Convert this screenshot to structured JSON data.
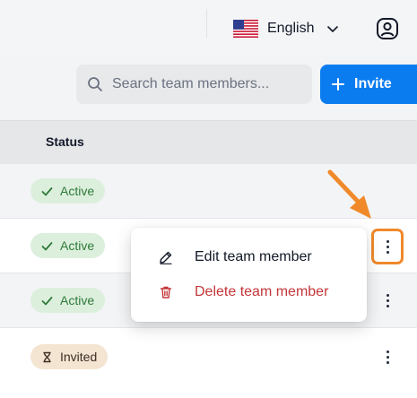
{
  "header": {
    "language": "English",
    "language_flag_icon": "us-flag-icon",
    "profile_icon": "user-circle-icon"
  },
  "toolbar": {
    "search_placeholder": "Search team members...",
    "invite_label": "Invite"
  },
  "table": {
    "columns": [
      "Status"
    ],
    "rows": [
      {
        "status": "Active",
        "type": "active"
      },
      {
        "status": "Active",
        "type": "active"
      },
      {
        "status": "Active",
        "type": "active"
      },
      {
        "status": "Invited",
        "type": "invited"
      }
    ]
  },
  "context_menu": {
    "edit_label": "Edit team member",
    "delete_label": "Delete team member"
  },
  "colors": {
    "accent": "#0a7cf0",
    "highlight": "#f0892a",
    "danger": "#c3363a",
    "active_bg": "#dcefdc",
    "active_text": "#2f7a3a",
    "invited_bg": "#f4e4d2"
  }
}
